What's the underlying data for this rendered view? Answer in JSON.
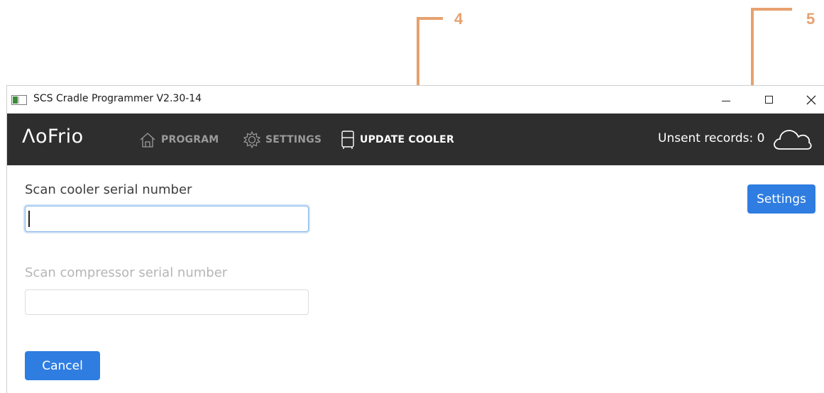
{
  "callouts": [
    {
      "number": "4"
    },
    {
      "number": "5"
    }
  ],
  "window": {
    "title": "SCS Cradle Programmer V2.30-14",
    "controls": {
      "minimize": "—",
      "maximize": "☐",
      "close": "✕"
    }
  },
  "header": {
    "logo": "ΛoFrio",
    "nav": [
      {
        "label": "PROGRAM",
        "icon": "home-icon",
        "active": false
      },
      {
        "label": "SETTINGS",
        "icon": "gear-icon",
        "active": false
      },
      {
        "label": "UPDATE COOLER",
        "icon": "cooler-icon",
        "active": true
      }
    ],
    "unsent_records": "Unsent records: 0",
    "cloud_icon": "cloud-icon"
  },
  "form": {
    "cooler_label": "Scan cooler serial number",
    "cooler_value": "",
    "compressor_label": "Scan compressor serial number",
    "compressor_value": "",
    "settings_button": "Settings",
    "cancel_button": "Cancel"
  },
  "colors": {
    "accent": "#2f7de1",
    "header_bg": "#2e2e2e",
    "callout": "#e7a16f"
  }
}
